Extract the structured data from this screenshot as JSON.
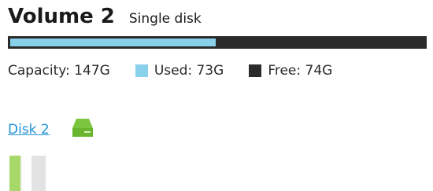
{
  "volume": {
    "title": "Volume 2",
    "type": "Single disk",
    "used_fraction": 0.497
  },
  "capacity": {
    "capacity_text": "Capacity: 147G",
    "used_text": "Used: 73G",
    "free_text": "Free: 74G"
  },
  "legend": {
    "used_color": "#89d1ea",
    "free_color": "#2b2b2b"
  },
  "disk": {
    "link_label": "Disk 2",
    "status_icon": "hard-drive-icon",
    "status_color": "#78c43b",
    "thumbnail_icon": "disk-slot-icon"
  }
}
